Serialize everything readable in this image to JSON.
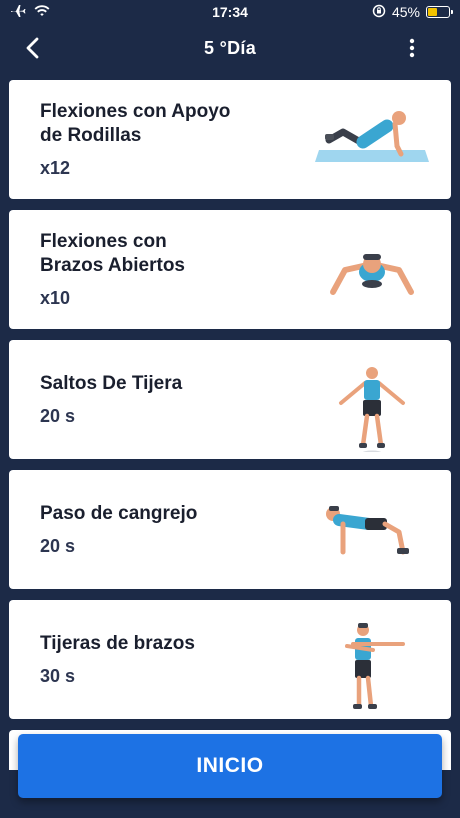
{
  "status": {
    "time": "17:34",
    "battery": "45%",
    "battery_level": 0.45
  },
  "header": {
    "title": "5 °Día"
  },
  "exercises": [
    {
      "name_line1": "Flexiones con Apoyo",
      "name_line2": "de Rodillas",
      "meta": "x12"
    },
    {
      "name_line1": "Flexiones con",
      "name_line2": "Brazos Abiertos",
      "meta": "x10"
    },
    {
      "name_line1": "Saltos De Tijera",
      "name_line2": "",
      "meta": "20 s"
    },
    {
      "name_line1": "Paso de cangrejo",
      "name_line2": "",
      "meta": "20 s"
    },
    {
      "name_line1": "Tijeras de brazos",
      "name_line2": "",
      "meta": "30 s"
    }
  ],
  "start_button": {
    "label": "INICIO"
  },
  "colors": {
    "background": "#1c2a47",
    "accent": "#1d72e4",
    "battery": "#f2c200"
  }
}
